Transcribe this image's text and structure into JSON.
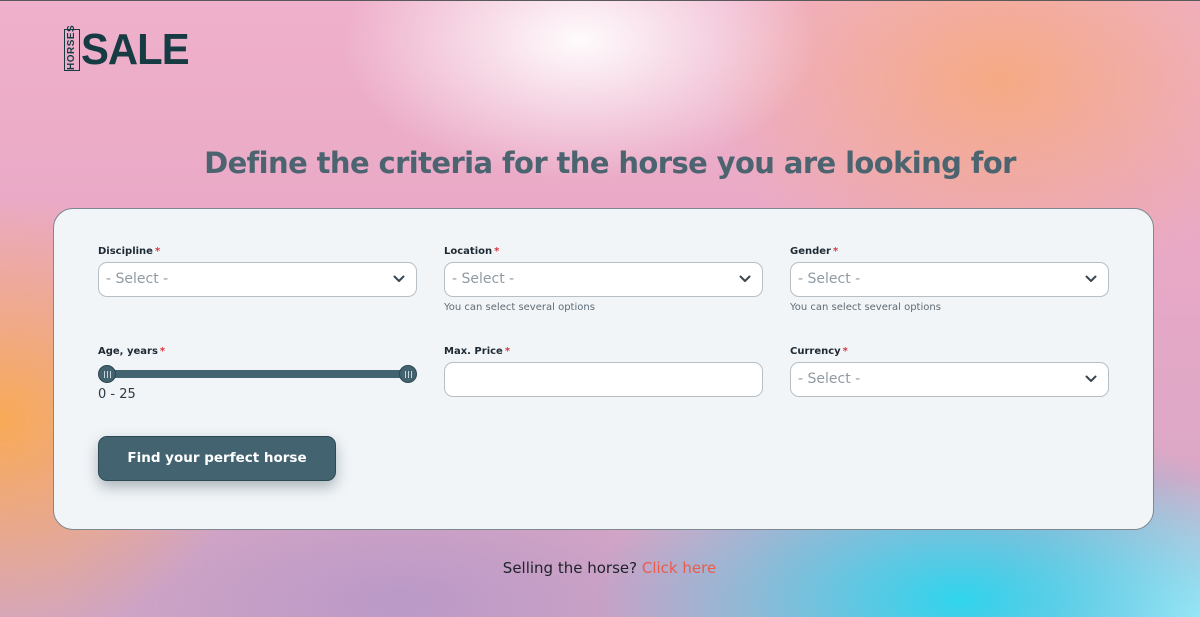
{
  "logo": {
    "side_text": "HORSES",
    "main_text": "SALE"
  },
  "heading": "Define the criteria for the horse you are looking for",
  "form": {
    "discipline": {
      "label": "Discipline",
      "required_mark": "*",
      "placeholder": "- Select -"
    },
    "location": {
      "label": "Location",
      "required_mark": "*",
      "placeholder": "- Select -",
      "hint": "You can select several options"
    },
    "gender": {
      "label": "Gender",
      "required_mark": "*",
      "placeholder": "- Select -",
      "hint": "You can select several options"
    },
    "age": {
      "label": "Age, years",
      "required_mark": "*",
      "min": 0,
      "max": 25,
      "range_text": "0 - 25"
    },
    "max_price": {
      "label": "Max. Price",
      "required_mark": "*",
      "value": ""
    },
    "currency": {
      "label": "Currency",
      "required_mark": "*",
      "placeholder": "- Select -"
    },
    "submit_label": "Find your perfect horse"
  },
  "footer": {
    "text": "Selling the horse?",
    "link_text": "Click here"
  },
  "colors": {
    "accent": "#436371",
    "link": "#ec5a4a",
    "required": "#d9363e",
    "heading": "#4b6470"
  },
  "icons": {
    "dropdown": "chevron-down-icon"
  }
}
